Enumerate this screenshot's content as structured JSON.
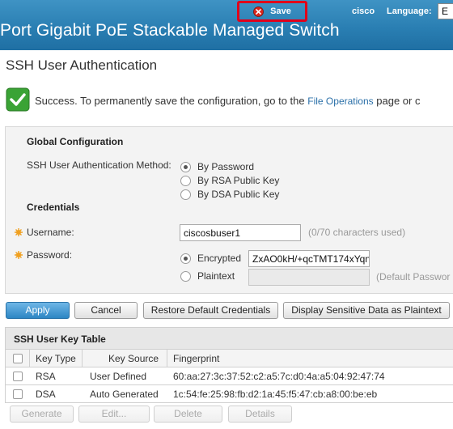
{
  "header": {
    "save_label": "Save",
    "user_link": "cisco",
    "language_label": "Language:",
    "language_value": "E",
    "product_title": "Port Gigabit PoE Stackable Managed Switch"
  },
  "page_title": "SSH User Authentication",
  "success": {
    "text_before": "Success. To permanently save the configuration, go to the",
    "link": "File Operations",
    "text_after": "page or c"
  },
  "global_config": {
    "heading": "Global Configuration",
    "method_label": "SSH User Authentication Method:",
    "methods": [
      {
        "label": "By Password",
        "selected": true
      },
      {
        "label": "By RSA Public Key",
        "selected": false
      },
      {
        "label": "By DSA Public Key",
        "selected": false
      }
    ]
  },
  "credentials": {
    "heading": "Credentials",
    "username_label": "Username:",
    "username_value": "ciscosbuser1",
    "username_hint": "(0/70 characters used)",
    "password_label": "Password:",
    "encrypted_label": "Encrypted",
    "encrypted_value": "ZxAO0kH/+qcTMT174xYqn",
    "encrypted_selected": true,
    "plaintext_label": "Plaintext",
    "plaintext_value": "",
    "plaintext_hint": "(Default Passwor"
  },
  "actions": {
    "apply": "Apply",
    "cancel": "Cancel",
    "restore": "Restore Default Credentials",
    "display": "Display Sensitive Data as Plaintext"
  },
  "key_table": {
    "title": "SSH User Key Table",
    "columns": [
      "Key Type",
      "Key Source",
      "Fingerprint"
    ],
    "rows": [
      {
        "type": "RSA",
        "source": "User Defined",
        "fingerprint": "60:aa:27:3c:37:52:c2:a5:7c:d0:4a:a5:04:92:47:74"
      },
      {
        "type": "DSA",
        "source": "Auto Generated",
        "fingerprint": "1c:54:fe:25:98:fb:d2:1a:45:f5:47:cb:a8:00:be:eb"
      }
    ],
    "buttons": {
      "generate": "Generate",
      "edit": "Edit...",
      "delete": "Delete",
      "details": "Details"
    }
  },
  "colors": {
    "header_blue": "#2a7fb3",
    "save_highlight": "#e0001a",
    "success_green": "#3aa335",
    "link_blue": "#2a6fa8",
    "required_orange": "#f0a020"
  }
}
